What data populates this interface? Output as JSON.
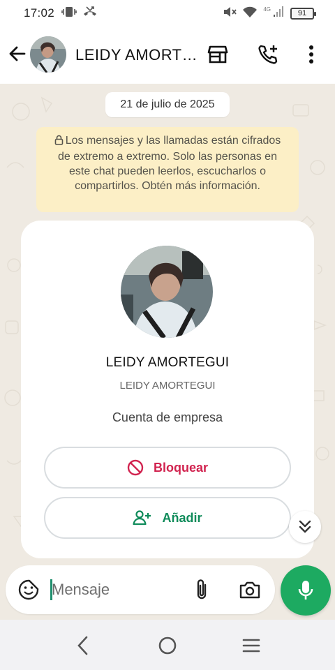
{
  "status_bar": {
    "time": "17:02",
    "battery": "91",
    "network_label": "4G",
    "icons": [
      "vibrate-icon",
      "missed-call-icon",
      "mute-icon",
      "wifi-icon",
      "signal-icon",
      "battery-icon"
    ]
  },
  "header": {
    "contact_name": "LEIDY AMORT…",
    "avatar_alt": "LEIDY AMORTEGUI",
    "icons": [
      "back-arrow-icon",
      "store-icon",
      "add-call-icon",
      "more-vertical-icon"
    ]
  },
  "chat": {
    "date_chip": "21 de julio de 2025",
    "encryption_notice": "Los mensajes y las llamadas están cifrados de extremo a extremo. Solo las personas en este chat pueden leerlos, escucharlos o compartirlos. Obtén más información."
  },
  "profile_card": {
    "name": "LEIDY AMORTEGUI",
    "subtitle": "LEIDY AMORTEGUI",
    "account_type": "Cuenta de empresa",
    "block_label": "Bloquear",
    "add_label": "Añadir"
  },
  "composer": {
    "placeholder": "Mensaje",
    "value": ""
  },
  "colors": {
    "accent_green": "#1daa61",
    "block_red": "#d1234f",
    "add_green": "#0f8b5a",
    "notice_bg": "#fcefc6",
    "chat_bg": "#efeae2"
  }
}
